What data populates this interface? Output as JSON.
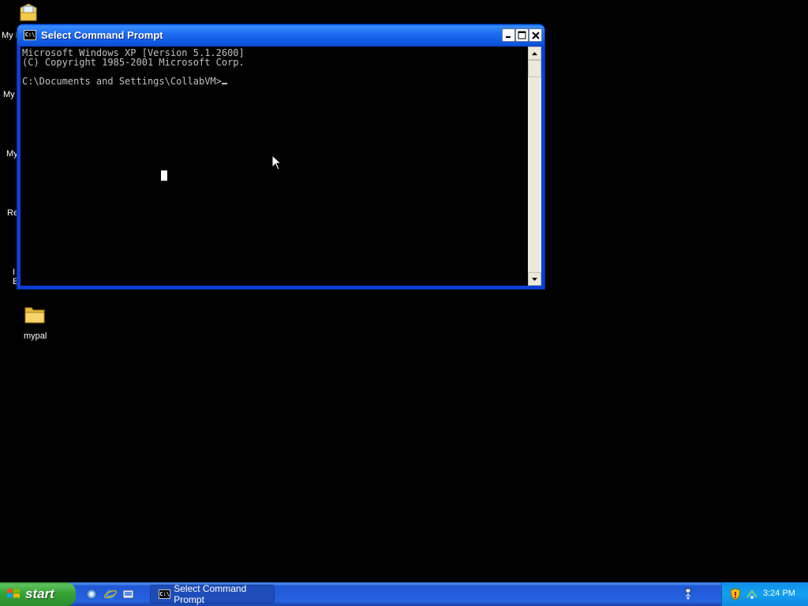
{
  "desktop": {
    "icons": [
      {
        "label": "My D",
        "icon": "my-documents-icon"
      },
      {
        "label": "My",
        "icon": "my-computer-icon"
      },
      {
        "label": "My",
        "icon": "my-network-places-icon"
      },
      {
        "label": "Re",
        "icon": "recycle-bin-icon"
      },
      {
        "label": "I",
        "label2": "E",
        "icon": "internet-explorer-icon"
      },
      {
        "label": "mypal",
        "icon": "folder-icon"
      }
    ]
  },
  "window": {
    "title": "Select Command Prompt",
    "icon_text": "C:\\",
    "console_lines": [
      "Microsoft Windows XP [Version 5.1.2600]",
      "(C) Copyright 1985-2001 Microsoft Corp.",
      "",
      "C:\\Documents and Settings\\CollabVM>"
    ]
  },
  "taskbar": {
    "start_label": "start",
    "task_button_label": "Select Command Prompt",
    "task_icon_text": "C:\\",
    "clock": "3:24 PM"
  },
  "colors": {
    "title_bar": "#0b5ce6",
    "console_bg": "#000000",
    "console_text": "#c0c0c0",
    "taskbar": "#2663e0",
    "start_button": "#37a337",
    "tray": "#14a0f0"
  }
}
